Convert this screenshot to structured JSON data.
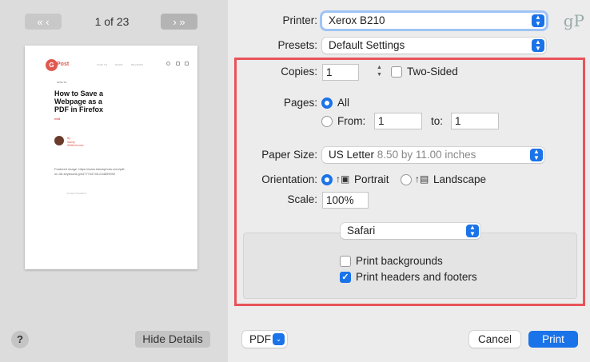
{
  "preview": {
    "page_count": "1 of 23",
    "prev_glyphs": "« ‹",
    "next_glyphs": "› »",
    "logo_letter": "G",
    "logo_text": "Post",
    "nav_links": [
      "HOW TO",
      "NEWS",
      "REVIEWS"
    ],
    "article_tag": "HOW-TO",
    "article_title": "How to Save a Webpage as a PDF in Firefox",
    "article_title_sup": "edit",
    "byline_by": "By",
    "byline_name": "Sandy Writtenhouse",
    "featured_text": "Featured image: https://www.istockphoto.com/pdf-on-3d-keyboard-gm477744746-244899092",
    "advertisement": "ADVERTISEMENT"
  },
  "left_footer": {
    "help_label": "?",
    "hide_details_label": "Hide Details"
  },
  "printer": {
    "label": "Printer:",
    "value": "Xerox B210"
  },
  "presets": {
    "label": "Presets:",
    "value": "Default Settings"
  },
  "brand_watermark": "gP",
  "copies": {
    "label": "Copies:",
    "value": "1",
    "two_sided_label": "Two-Sided",
    "two_sided_checked": false
  },
  "pages": {
    "label": "Pages:",
    "all_label": "All",
    "from_label": "From:",
    "from_value": "1",
    "to_label": "to:",
    "to_value": "1",
    "selected": "All"
  },
  "paper_size": {
    "label": "Paper Size:",
    "value": "US Letter",
    "detail": "8.50 by 11.00 inches"
  },
  "orientation": {
    "label": "Orientation:",
    "portrait_label": "Portrait",
    "landscape_label": "Landscape",
    "selected": "Portrait"
  },
  "scale": {
    "label": "Scale:",
    "value": "100%"
  },
  "app_section": {
    "app_value": "Safari",
    "print_backgrounds_label": "Print backgrounds",
    "print_backgrounds_checked": false,
    "print_headers_footers_label": "Print headers and footers",
    "print_headers_footers_checked": true
  },
  "footer": {
    "pdf_label": "PDF",
    "cancel_label": "Cancel",
    "print_label": "Print"
  },
  "colors": {
    "accent": "#1a73e8",
    "highlight_box": "#e8535a"
  }
}
